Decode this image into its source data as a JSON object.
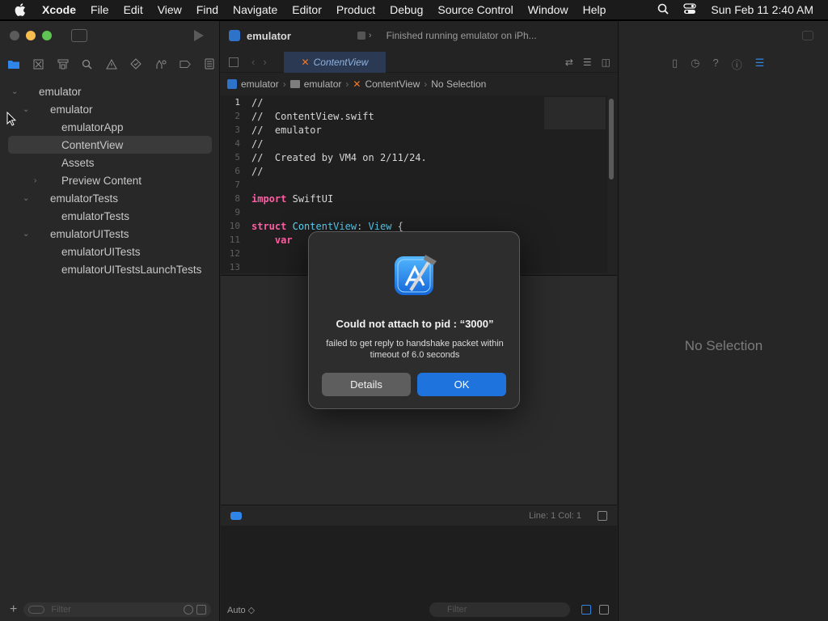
{
  "menubar": {
    "app": "Xcode",
    "menus": [
      "File",
      "Edit",
      "View",
      "Find",
      "Navigate",
      "Editor",
      "Product",
      "Debug",
      "Source Control",
      "Window",
      "Help"
    ],
    "clock": "Sun Feb 11  2:40 AM"
  },
  "toolbar": {
    "project": "emulator",
    "status": "Finished running emulator on iPh..."
  },
  "tab": {
    "label": "ContentView"
  },
  "breadcrumb": {
    "items": [
      "emulator",
      "emulator",
      "ContentView",
      "No Selection"
    ]
  },
  "navigator": {
    "items": [
      {
        "label": "emulator"
      },
      {
        "label": "emulator"
      },
      {
        "label": "emulatorApp"
      },
      {
        "label": "ContentView"
      },
      {
        "label": "Assets"
      },
      {
        "label": "Preview Content"
      },
      {
        "label": "emulatorTests"
      },
      {
        "label": "emulatorTests"
      },
      {
        "label": "emulatorUITests"
      },
      {
        "label": "emulatorUITests"
      },
      {
        "label": "emulatorUITestsLaunchTests"
      }
    ],
    "filter_placeholder": "Filter"
  },
  "code": {
    "line_numbers": [
      "1",
      "2",
      "3",
      "4",
      "5",
      "6",
      "7",
      "8",
      "9",
      "10",
      "11",
      "12",
      "13"
    ]
  },
  "debugbar": {
    "position": "Line: 1  Col: 1"
  },
  "bottombar": {
    "auto": "Auto ◇",
    "filter_placeholder": "Filter"
  },
  "inspector": {
    "no_selection": "No Selection"
  },
  "alert": {
    "title": "Could not attach to pid : “3000”",
    "message": "failed to get reply to handshake packet within timeout of 6.0 seconds",
    "details_button": "Details",
    "ok_button": "OK"
  },
  "colors": {
    "accent": "#1e73dd",
    "swift_orange": "#ef7a31"
  }
}
